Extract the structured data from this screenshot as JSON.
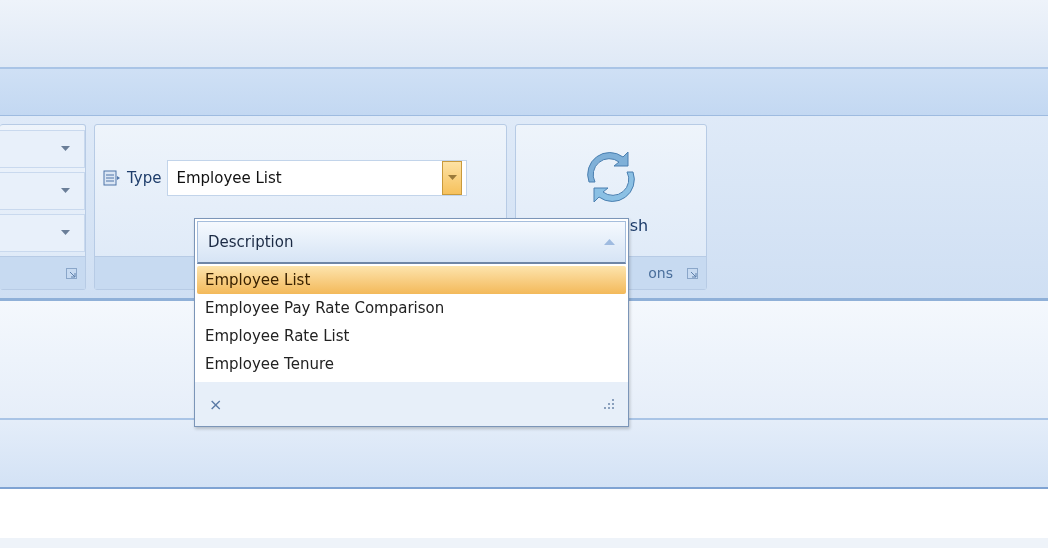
{
  "ribbon": {
    "type_group": {
      "label": "Type",
      "value": "Employee List"
    },
    "actions_group": {
      "button": "sh",
      "caption": "ons"
    }
  },
  "dropdown": {
    "header": "Description",
    "items": [
      {
        "label": "Employee List",
        "selected": true
      },
      {
        "label": "Employee Pay Rate Comparison",
        "selected": false
      },
      {
        "label": "Employee Rate List",
        "selected": false
      },
      {
        "label": "Employee Tenure",
        "selected": false
      }
    ],
    "clear": "×"
  }
}
